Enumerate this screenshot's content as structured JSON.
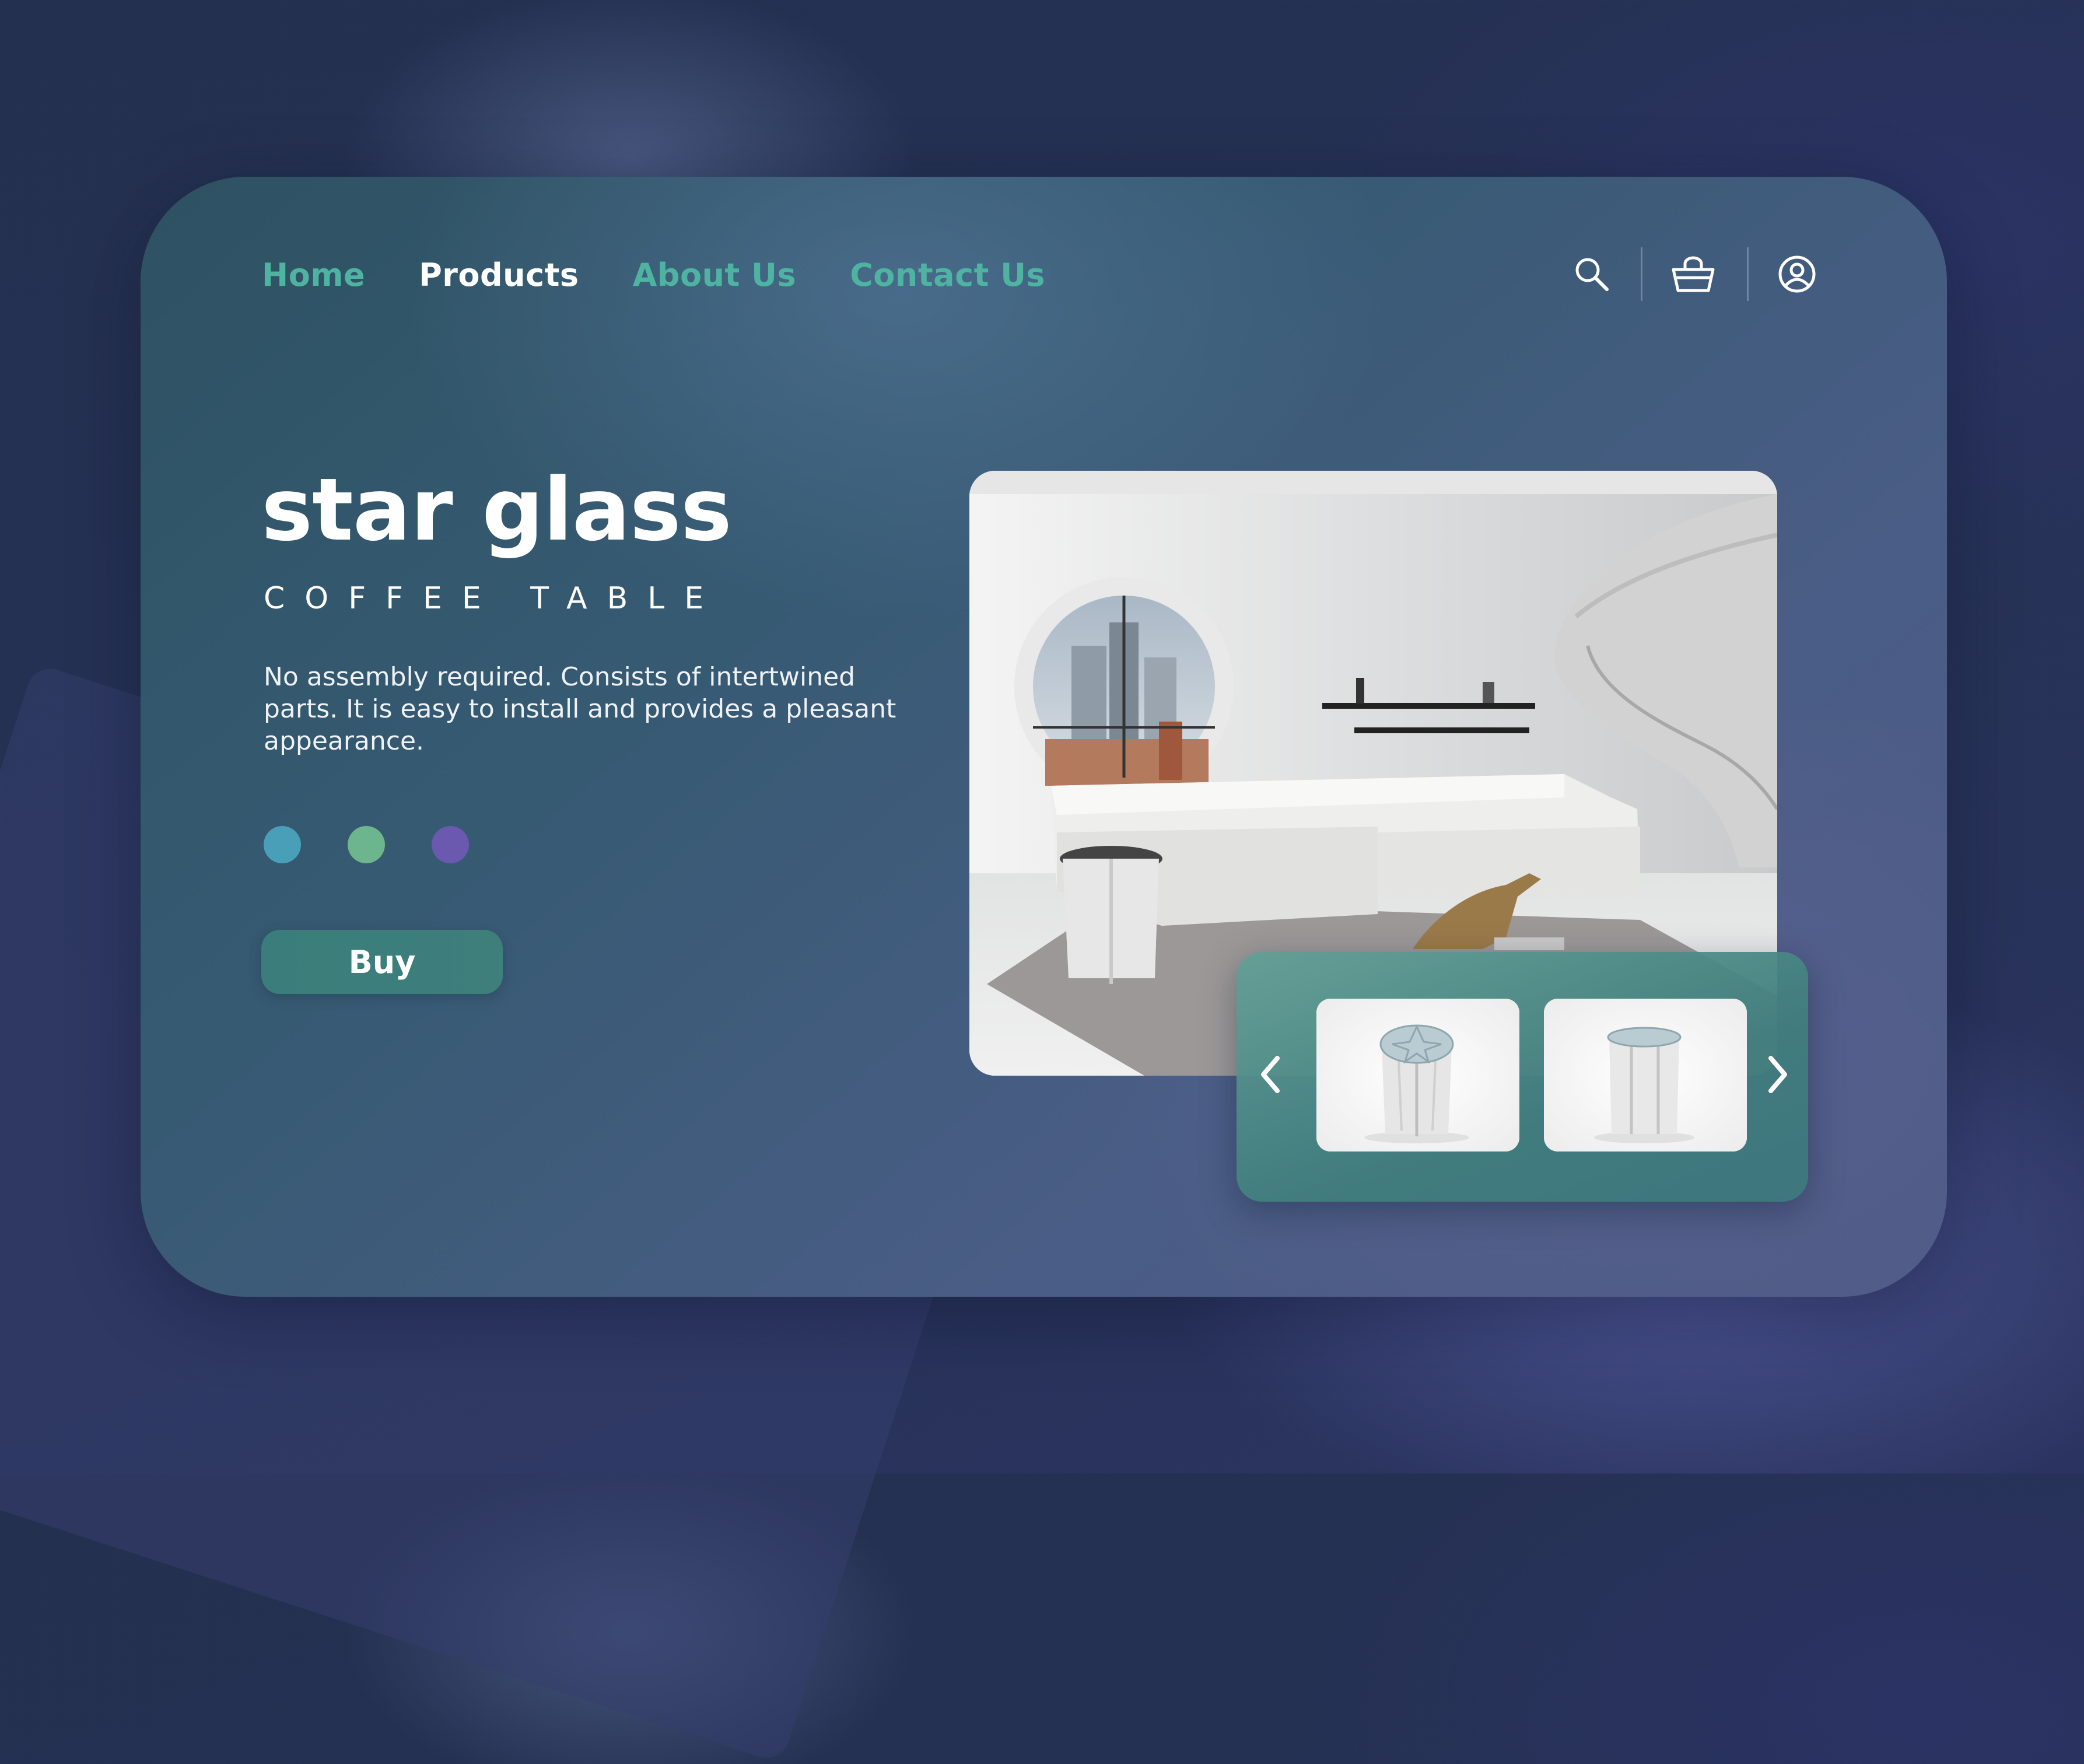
{
  "nav": {
    "items": [
      {
        "label": "Home",
        "active": false
      },
      {
        "label": "Products",
        "active": true
      },
      {
        "label": "About Us",
        "active": false
      },
      {
        "label": "Contact Us",
        "active": false
      }
    ]
  },
  "header_icons": [
    "search-icon",
    "basket-icon",
    "user-circle-icon"
  ],
  "hero": {
    "title": "star glass",
    "subtitle": "COFFEE TABLE",
    "description": "No assembly required. Consists of intertwined parts. It is easy to install and provides a pleasant appearance.",
    "color_options": [
      "#4a9fb8",
      "#6db58c",
      "#6b59b0"
    ],
    "buy_label": "Buy"
  },
  "carousel": {
    "prev_icon": "chevron-left-icon",
    "next_icon": "chevron-right-icon",
    "thumbnails": [
      "table-top-view",
      "table-side-view"
    ]
  },
  "colors": {
    "accent": "#4fb3a2",
    "panel": "#365a72",
    "button": "#3a7d7a"
  }
}
